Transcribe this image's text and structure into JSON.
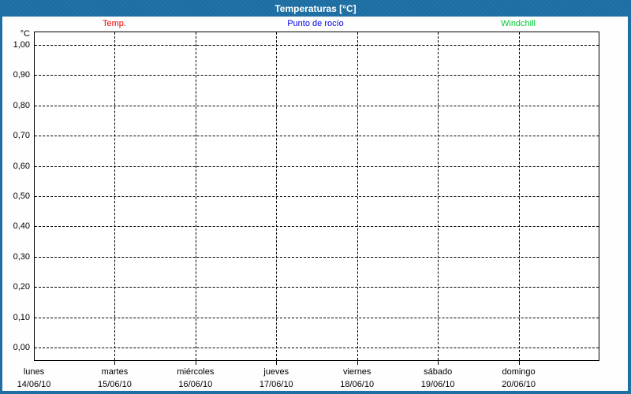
{
  "window": {
    "title": "Temperaturas [°C]"
  },
  "legend": [
    {
      "label": "Temp.",
      "color": "#ee0000"
    },
    {
      "label": "Punto de rocío",
      "color": "#0000ee"
    },
    {
      "label": "Windchill",
      "color": "#00cc33"
    }
  ],
  "colors": {
    "frame": "#1d6fa4",
    "titlebar_text": "#ffffff",
    "grid": "#000000",
    "plot_background": "#ffffff"
  },
  "chart_data": {
    "type": "line",
    "title": "Temperaturas [°C]",
    "xlabel": "",
    "ylabel": "°C",
    "ylim": [
      0.0,
      1.0
    ],
    "y_tick_labels": [
      "1,00",
      "0,90",
      "0,80",
      "0,70",
      "0,60",
      "0,50",
      "0,40",
      "0,30",
      "0,20",
      "0,10",
      "0,00"
    ],
    "grid": "dashed, on",
    "legend_position": "top",
    "x_days": [
      {
        "day": "lunes",
        "date": "14/06/10"
      },
      {
        "day": "martes",
        "date": "15/06/10"
      },
      {
        "day": "miércoles",
        "date": "16/06/10"
      },
      {
        "day": "jueves",
        "date": "17/06/10"
      },
      {
        "day": "viernes",
        "date": "18/06/10"
      },
      {
        "day": "sábado",
        "date": "19/06/10"
      },
      {
        "day": "domingo",
        "date": "20/06/10"
      }
    ],
    "series": [
      {
        "name": "Temp.",
        "color": "#ee0000",
        "values": []
      },
      {
        "name": "Punto de rocío",
        "color": "#0000ee",
        "values": []
      },
      {
        "name": "Windchill",
        "color": "#00cc33",
        "values": []
      }
    ]
  }
}
